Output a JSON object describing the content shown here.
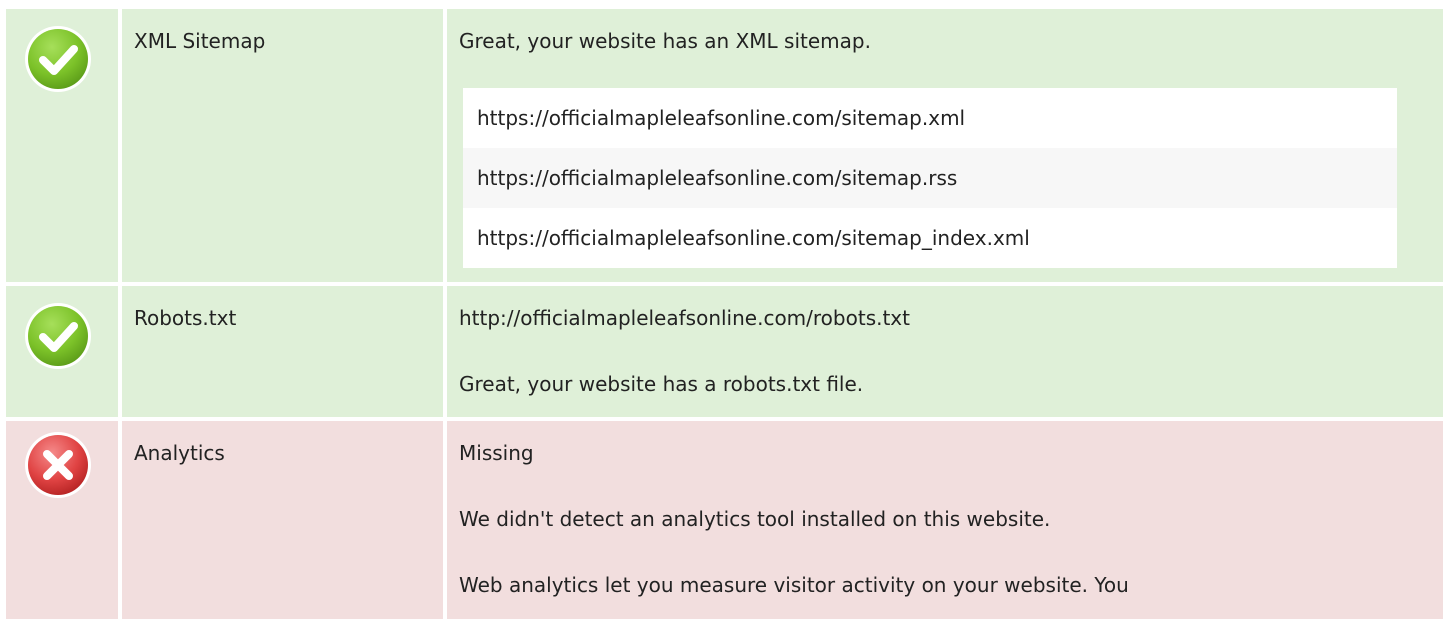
{
  "rows": [
    {
      "status": "pass",
      "icon": "check-circle-icon",
      "name": "XML Sitemap",
      "message": "Great, your website has an XML sitemap.",
      "sitemaps": [
        "https://officialmapleleafsonline.com/sitemap.xml",
        "https://officialmapleleafsonline.com/sitemap.rss",
        "https://officialmapleleafsonline.com/sitemap_index.xml"
      ]
    },
    {
      "status": "pass",
      "icon": "check-circle-icon",
      "name": "Robots.txt",
      "url": "http://officialmapleleafsonline.com/robots.txt",
      "message": "Great, your website has a robots.txt file."
    },
    {
      "status": "fail",
      "icon": "cross-circle-icon",
      "name": "Analytics",
      "status_text": "Missing",
      "message": "We didn't detect an analytics tool installed on this website.",
      "description": "Web analytics let you measure visitor activity on your website. You"
    }
  ],
  "colors": {
    "pass_bg": "#dff0d8",
    "fail_bg": "#f2dede",
    "pass_icon": "#7cc229",
    "fail_icon": "#e04343"
  }
}
